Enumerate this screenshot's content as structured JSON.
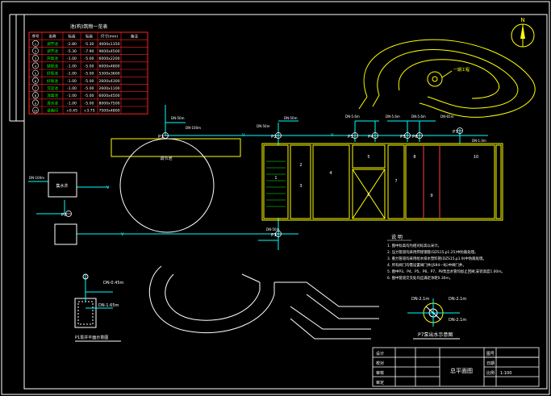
{
  "colors": {
    "background": "#000000",
    "border": "#ffffff",
    "pipe": "#00ffff",
    "structure": "#ffff00",
    "table": "#ff2020",
    "green": "#00ff00",
    "white": "#ffffff",
    "orange": "#ff9900"
  },
  "north_arrow": {
    "label": "N"
  },
  "elevation_table": {
    "title": "池(构)筑物一览表",
    "headers": [
      "序号",
      "名称",
      "标高",
      "标高",
      "尺寸(mm)",
      "备注"
    ],
    "rows": [
      {
        "no": "1",
        "name": "调节池",
        "a": "-2.80",
        "b": "-5.30",
        "size": "4000x1350",
        "note": ""
      },
      {
        "no": "2",
        "name": "调节池",
        "a": "-5.30",
        "b": "-7.90",
        "size": "9600x4500",
        "note": ""
      },
      {
        "no": "3",
        "name": "厌氧池",
        "a": "-1.00",
        "b": "-5.00",
        "size": "6000x2200",
        "note": ""
      },
      {
        "no": "4",
        "name": "缺氧池",
        "a": "-1.00",
        "b": "-5.00",
        "size": "6000x4800",
        "note": ""
      },
      {
        "no": "5",
        "name": "好氧池",
        "a": "-1.00",
        "b": "-5.00",
        "size": "5300x3600",
        "note": ""
      },
      {
        "no": "6",
        "name": "好氧池",
        "a": "-1.00",
        "b": "-5.00",
        "size": "2600x4300",
        "note": ""
      },
      {
        "no": "7",
        "name": "沉淀池",
        "a": "-1.00",
        "b": "-5.00",
        "size": "2600x1100",
        "note": ""
      },
      {
        "no": "8",
        "name": "消毒池",
        "a": "-1.00",
        "b": "-5.00",
        "size": "6000x4500",
        "note": ""
      },
      {
        "no": "9",
        "name": "清水池",
        "a": "-1.00",
        "b": "-5.00",
        "size": "8000x7500",
        "note": ""
      },
      {
        "no": "10",
        "name": "设备间",
        "a": "+0.45",
        "b": "+3.75",
        "size": "7500x4800",
        "note": ""
      }
    ]
  },
  "pump_labels": [
    "P1",
    "P2",
    "P3",
    "P4",
    "P5",
    "P6",
    "P7",
    "P8",
    "P1"
  ],
  "pipe_labels": [
    "DN-50m",
    "DN-100m",
    "DN-50m",
    "DN-50m",
    "DN-5.6m",
    "DN-5.6m",
    "DN-5.6m",
    "DN-65m",
    "DN-1.0m",
    "DN-100m",
    "DN-50m"
  ],
  "pipe_flow_mark": "V",
  "structure_labels": {
    "round_tank": "调节池",
    "well": "集水井",
    "cell_1": "1",
    "cell_2": "2",
    "cell_3": "3",
    "cell_4": "4",
    "cell_5": "5",
    "cell_6": "6",
    "cell_7": "7",
    "cell_8": "8",
    "cell_9": "9",
    "cell_10": "10",
    "landmark": "一期工程"
  },
  "notes": {
    "title": "说  明",
    "lines": [
      "1. 图中标高均为相对标高以米计。",
      "2. 压力管道均采用焊接钢管(DZS15,p1.25)中防腐处理。",
      "3. 重力管道均采用给水排水塑料管(DZS15,p1.9)中防腐处理。",
      "4. 所有阀门均需设置阀门井(JS94—标)中阀门井。",
      "5. 图中P3、P4、P5、P6、P7、P8泵出水管均加止回阀,安装高度1.00m。",
      "6. 图中管道交叉处均应满足净距0.30m。"
    ]
  },
  "detail_p1": {
    "title": "P1泵井平面示意图",
    "label_top": "DN-0.45m",
    "label_right": "DN-1.65m"
  },
  "detail_p7": {
    "title": "P7泵出水示意图",
    "label_left": "DN-2.1m",
    "label_right": "DN-2.1m",
    "label_bottom": "DN-2.1m"
  },
  "title_block": {
    "drawing_name": "总平面图",
    "scale": "1:100",
    "rows": [
      "设计",
      "校对",
      "审核",
      "审定"
    ],
    "cells": [
      "图号",
      "日期",
      "比例"
    ]
  }
}
